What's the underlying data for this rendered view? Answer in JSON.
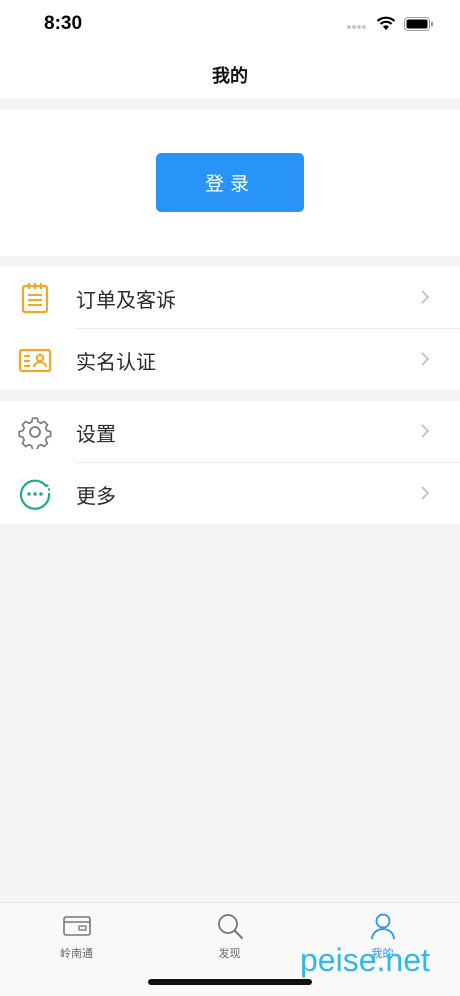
{
  "status": {
    "time": "8:30"
  },
  "nav": {
    "title": "我的"
  },
  "login": {
    "label": "登录"
  },
  "menu_group_1": [
    {
      "label": "订单及客诉",
      "icon": "clipboard-list-icon"
    },
    {
      "label": "实名认证",
      "icon": "id-card-icon"
    }
  ],
  "menu_group_2": [
    {
      "label": "设置",
      "icon": "gear-icon"
    },
    {
      "label": "更多",
      "icon": "more-circle-icon"
    }
  ],
  "tabs": [
    {
      "label": "岭南通",
      "icon": "card-icon",
      "active": false
    },
    {
      "label": "发现",
      "icon": "search-icon",
      "active": false
    },
    {
      "label": "我的",
      "icon": "user-icon",
      "active": true
    }
  ],
  "watermark": "peise.net",
  "colors": {
    "accent": "#2894f8",
    "orange": "#f5a623",
    "green": "#1aab8a",
    "gray_icon": "#7a7a7a"
  }
}
